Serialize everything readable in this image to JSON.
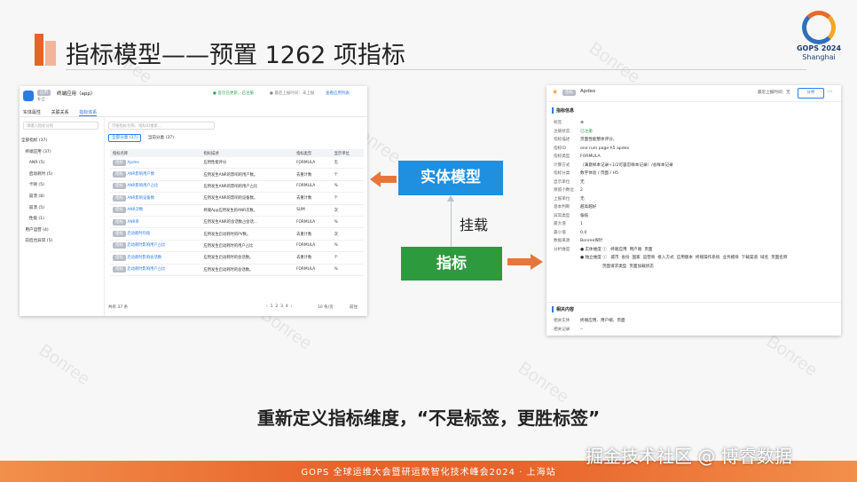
{
  "slide": {
    "title": "指标模型——预置 1262 项指标",
    "watermark": "Bonree",
    "logo": {
      "line1": "GOPS 2024",
      "line2": "Shanghai"
    },
    "slogan": "重新定义指标维度，“不是标签，更胜标签”",
    "footer": "GOPS 全球运维大会暨研运数智化技术峰会2024 · 上海站",
    "credit": "掘金技术社区 @ 博睿数据"
  },
  "diagram": {
    "entity_label": "实体模型",
    "metric_label": "指标",
    "mount_label": "挂载",
    "colors": {
      "entity": "#1f8fe0",
      "metric": "#2e9a3e",
      "arrow": "#e8763a"
    }
  },
  "left_panel": {
    "app_tag": "应用",
    "app_name": "终端应用（app）",
    "sub": "补全",
    "status1": "● 首页已更新，已注册",
    "status2": "● 最后上报时间：未上报",
    "status3": "查看应用列表",
    "tabs": [
      "实体属性",
      "关联关系",
      "指标体系"
    ],
    "active_tab": 2,
    "search_placeholder": "请输入指标分组",
    "tree": [
      "全部指标 (37)",
      "   终端应用 (37)",
      "      ANR (5)",
      "      启动耗时 (5)",
      "      卡顿 (5)",
      "      崩溃 (8)",
      "      崩溃 (5)",
      "      性能 (1)",
      "   用户运营 (4)",
      "   前后台异常 (5)"
    ],
    "main_search_placeholder": "可按指标名称、指标ID搜索...",
    "main_tabs": [
      "全部分类 (37)",
      "当前分类 (37)"
    ],
    "columns": [
      "指标名称",
      "指标描述",
      "指标类型",
      "显示单位"
    ],
    "rows": [
      {
        "tag": "指标",
        "name": "Apdex",
        "desc": "应用性能评分",
        "type": "FORMULA",
        "unit": "无"
      },
      {
        "tag": "指标",
        "name": "ANR影响用户数",
        "desc": "应用发生ANR的影响的用户数。",
        "type": "去重计数",
        "unit": "个"
      },
      {
        "tag": "指标",
        "name": "ANR影响用户占比",
        "desc": "应用发生ANR的影响的用户占比",
        "type": "FORMULA",
        "unit": "%"
      },
      {
        "tag": "指标",
        "name": "ANR影响设备数",
        "desc": "应用发生ANR的影响的设备数。",
        "type": "去重计数",
        "unit": "个"
      },
      {
        "tag": "指标",
        "name": "ANR次数",
        "desc": "终端App应用发生的ANR次数。",
        "type": "SUM",
        "unit": "次"
      },
      {
        "tag": "指标",
        "name": "ANR率",
        "desc": "应用发生ANR的会话数占会话...",
        "type": "FORMULA",
        "unit": "%"
      },
      {
        "tag": "指标",
        "name": "启动耗时均值",
        "desc": "应用发生启动耗时的PV数。",
        "type": "去重计数",
        "unit": "次"
      },
      {
        "tag": "指标",
        "name": "启动耗时影响用户占比",
        "desc": "应用发生启动耗时的用户占比",
        "type": "FORMULA",
        "unit": "%"
      },
      {
        "tag": "指标",
        "name": "启动耗时影响会话数",
        "desc": "应用发生启动耗时的会话数。",
        "type": "去重计数",
        "unit": "个"
      },
      {
        "tag": "指标",
        "name": "启动耗时影响用户占比",
        "desc": "应用发生启动耗时的会话数。",
        "type": "FORMULA",
        "unit": "%"
      }
    ],
    "pager": {
      "total": "共有 37 条",
      "pages": "‹  1  2  3  4  ›",
      "size": "10 条/页",
      "goto": "前往"
    }
  },
  "right_panel": {
    "tag": "指标",
    "name": "Apdex",
    "updated": "最近上报时间：无",
    "share": "分析",
    "section1": "指标信息",
    "props": [
      {
        "k": "标签",
        "v": "⊕"
      },
      {
        "k": "注册状态",
        "v": "已注册",
        "green": true
      },
      {
        "k": "指标描述",
        "v": "页面性能整体评分。"
      },
      {
        "k": "指标ID",
        "v": "one rum page h5 apdex"
      },
      {
        "k": "指标类型",
        "v": "FORMULA"
      },
      {
        "k": "计算方式",
        "v": "（满意样本记录+1/2可容忍样本记录）/总样本记录"
      },
      {
        "k": "指标分类",
        "v": "数字体验 / 页面 / H5"
      },
      {
        "k": "显示单位",
        "v": "无"
      },
      {
        "k": "保留小数位",
        "v": "2"
      },
      {
        "k": "上报单位",
        "v": "无"
      },
      {
        "k": "基本判断",
        "v": "越高越好"
      },
      {
        "k": "异常类型",
        "v": "偏低"
      },
      {
        "k": "最大值",
        "v": "1"
      },
      {
        "k": "最小值",
        "v": "0.0"
      },
      {
        "k": "数据来源",
        "v": "Bonree探针"
      },
      {
        "k": "分析维度",
        "v": "● 实体维度 ⓘ   终端应用  用户端  页面"
      },
      {
        "k": "",
        "v": "● 独立维度 ⓘ   城市  省份  国家  运营商  接入方式  应用版本  终端操作系统  业务模块  下载渠道  域名  页面名称"
      },
      {
        "k": "",
        "v": "                 页面请求类型  页面加载状态"
      }
    ],
    "section2": "相关内容",
    "related": [
      {
        "k": "相关实体",
        "v": "终端应用、用户端、页面"
      },
      {
        "k": "相关记录",
        "v": "--"
      }
    ]
  }
}
